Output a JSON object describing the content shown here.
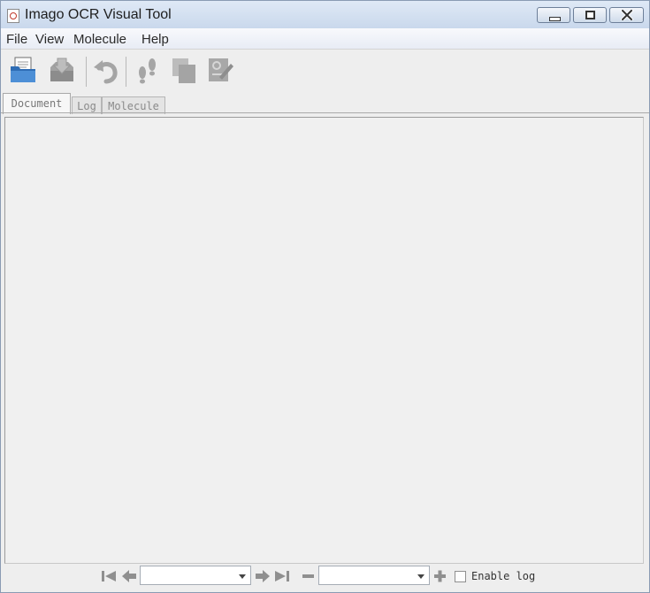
{
  "window": {
    "title": "Imago OCR Visual Tool",
    "icon": "app-document-icon",
    "controls": [
      "minimize-icon",
      "maximize-icon",
      "close-icon"
    ]
  },
  "menu": {
    "items": [
      {
        "label": "File"
      },
      {
        "label": "View"
      },
      {
        "label": "Molecule"
      },
      {
        "label": "Help"
      }
    ]
  },
  "toolbar": {
    "buttons": [
      {
        "icon": "open-folder-icon",
        "enabled": true
      },
      {
        "icon": "save-icon",
        "enabled": false
      },
      {
        "icon": "undo-icon",
        "enabled": false
      },
      {
        "icon": "footsteps-icon",
        "enabled": false
      },
      {
        "icon": "copy-icon",
        "enabled": false
      },
      {
        "icon": "edit-molecule-icon",
        "enabled": false
      }
    ]
  },
  "tabs": [
    {
      "label": "Document",
      "active": true
    },
    {
      "label": "Log",
      "active": false
    },
    {
      "label": "Molecule",
      "active": false
    }
  ],
  "navigation": {
    "page_select_value": "",
    "zoom_select_value": "",
    "icons": [
      "first-page-icon",
      "prev-page-icon",
      "next-page-icon",
      "last-page-icon",
      "zoom-out-icon",
      "zoom-in-icon"
    ],
    "enable_log_label": "Enable log",
    "enable_log_checked": false
  },
  "colors": {
    "titlebar": "#c9d8ec",
    "background": "#eeeeee",
    "disabled_icon": "#a8a8a8",
    "open_icon_blue": "#3b7cc4"
  }
}
